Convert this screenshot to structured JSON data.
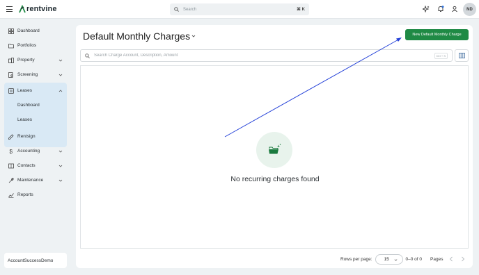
{
  "app": {
    "brand": "rentvine",
    "search": {
      "placeholder": "Search",
      "shortcut": "⌘ K"
    },
    "user_initials": "ND",
    "account": "AccountSuccessDemo"
  },
  "icons": {
    "menu": "hamburger-icon",
    "ai": "sparkle-icon",
    "notifications": "bell-icon",
    "profile": "user-icon",
    "search": "search-icon",
    "columns": "columns-icon",
    "empty": "folder-open-icon"
  },
  "sidebar": {
    "items": [
      {
        "key": "dashboard",
        "label": "Dashboard"
      },
      {
        "key": "portfolios",
        "label": "Portfolios"
      },
      {
        "key": "property",
        "label": "Property"
      },
      {
        "key": "screening",
        "label": "Screening"
      },
      {
        "key": "leases",
        "label": "Leases"
      },
      {
        "key": "rentsign",
        "label": "Rentsign"
      },
      {
        "key": "accounting",
        "label": "Accounting"
      },
      {
        "key": "contacts",
        "label": "Contacts"
      },
      {
        "key": "maintenance",
        "label": "Maintenance"
      },
      {
        "key": "reports",
        "label": "Reports"
      }
    ],
    "leases_sub": [
      {
        "label": "Dashboard"
      },
      {
        "label": "Leases"
      }
    ]
  },
  "main": {
    "title": "Default Monthly Charges",
    "primary_action": "New Default Monthly Charge",
    "filter_placeholder": "Search Charge Account, Description, Amount",
    "filter_hint": "Ctrl + S",
    "empty_message": "No recurring charges found",
    "pagination": {
      "rows_label": "Rows per page:",
      "rows_value": "15",
      "range": "0–0 of 0",
      "pages_label": "Pages"
    }
  },
  "colors": {
    "accent": "#1f8a45",
    "active_nav_bg": "#d9e9f5",
    "annotation_arrow": "#2340d8"
  }
}
